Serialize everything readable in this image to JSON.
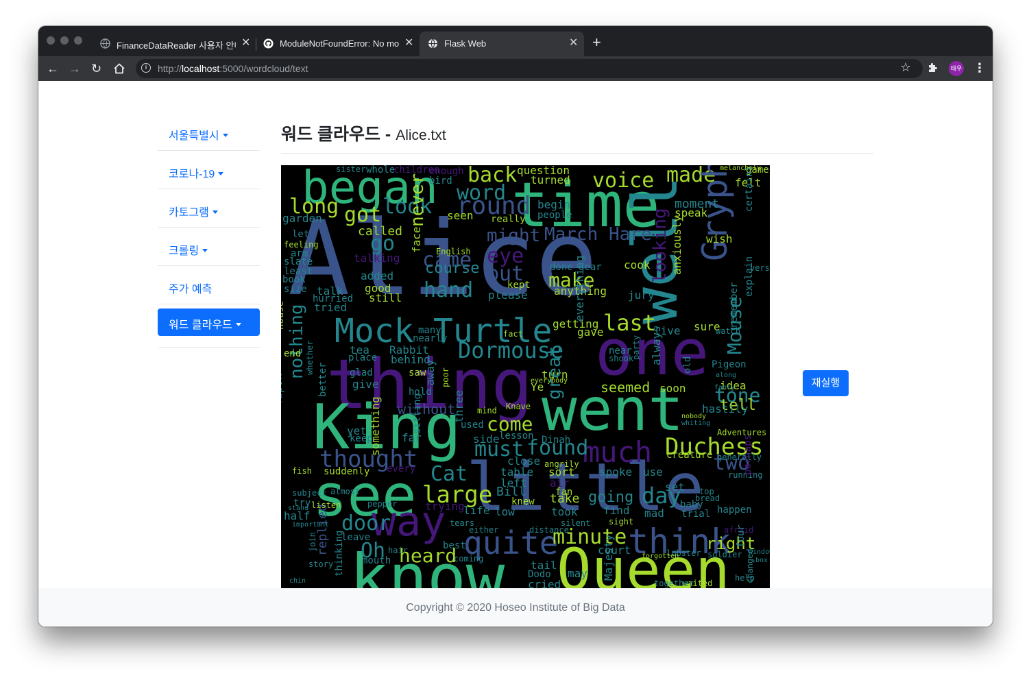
{
  "browser": {
    "tabs": [
      {
        "title": "FinanceDataReader 사용자 안내서",
        "icon": "globe-icon"
      },
      {
        "title": "ModuleNotFoundError: No module",
        "icon": "github-icon"
      },
      {
        "title": "Flask Web",
        "icon": "globe-icon",
        "active": true
      }
    ],
    "url_scheme": "http://",
    "url_host": "localhost",
    "url_rest": ":5000/wordcloud/text",
    "avatar_text": "태우"
  },
  "sidebar": {
    "items": [
      {
        "label": "서울특별시",
        "dropdown": true
      },
      {
        "label": "코로나-19",
        "dropdown": true
      },
      {
        "label": "카토그램",
        "dropdown": true
      },
      {
        "label": "크롤링",
        "dropdown": true
      },
      {
        "label": "주가 예측",
        "dropdown": false
      },
      {
        "label": "워드 클라우드",
        "dropdown": true,
        "active": true
      }
    ]
  },
  "main": {
    "title": "워드 클라우드",
    "separator": "-",
    "filename": "Alice.txt",
    "rerun_label": "재실행"
  },
  "wordcloud": {
    "colors": {
      "green": "#2fb47c",
      "lime": "#a6db2d",
      "teal": "#24868e",
      "blue": "#3a538b",
      "purple": "#46177a",
      "cyan": "#1fa187",
      "yellowgreen": "#7ad151"
    },
    "words": [
      "Alice",
      "time",
      "well",
      "one",
      "thing",
      "King",
      "went",
      "see",
      "little",
      "know",
      "Queen",
      "began",
      "voice",
      "back",
      "word",
      "made",
      "Gryphon",
      "Mock",
      "Turtle",
      "Dormouse",
      "Duchess",
      "much",
      "must",
      "found",
      "thought",
      "large",
      "way",
      "quite",
      "minute",
      "think",
      "heard",
      "door",
      "Oh",
      "right",
      "two",
      "tone",
      "come",
      "Cat",
      "Bill",
      "day",
      "going",
      "take",
      "last",
      "looking",
      "Mouse",
      "first",
      "nothing",
      "long",
      "got",
      "look",
      "round",
      "seen",
      "might",
      "March",
      "Hare",
      "go",
      "came",
      "course",
      "eye",
      "put",
      "make",
      "hand",
      "never",
      "face",
      "garden",
      "called",
      "talking",
      "added",
      "good",
      "still",
      "said",
      "moment",
      "speak",
      "felt",
      "wish",
      "sure",
      "live",
      "tea",
      "Rabbit",
      "behind",
      "saw",
      "hold",
      "give",
      "glad",
      "without",
      "yet",
      "keep",
      "far",
      "side",
      "mind",
      "close",
      "table",
      "sort",
      "spoke",
      "use",
      "left",
      "knew",
      "took",
      "find",
      "mad",
      "happen",
      "sight",
      "court",
      "lobster",
      "soldier",
      "waited",
      "mouth",
      "leave",
      "Dodo",
      "cried",
      "gave",
      "getting",
      "near",
      "shook",
      "seemed",
      "soon",
      "idea",
      "Ye",
      "turn",
      "great",
      "sitting",
      "tell",
      "hastily",
      "creature",
      "Adventures",
      "afraid",
      "help",
      "Majesty",
      "question",
      "turned",
      "people",
      "begin",
      "jury",
      "anything",
      "kept",
      "please",
      "dear",
      "done",
      "cook",
      "replied",
      "suddenly",
      "every",
      "something",
      "three",
      "used",
      "lesson",
      "Dinah",
      "trying",
      "life",
      "low",
      "fish",
      "half",
      "together",
      "whole",
      "children",
      "sister",
      "enough",
      "bird",
      "game",
      "melancholy",
      "really",
      "English",
      "tried",
      "hurried",
      "talk",
      "arm",
      "slate",
      "least",
      "book",
      "size",
      "feeling",
      "let",
      "anxiously",
      "everything",
      "remember",
      "explain",
      "certainly",
      "verse",
      "away",
      "upon",
      "house",
      "end",
      "place",
      "whether",
      "better",
      "appeared",
      "poor",
      "fact",
      "nearly",
      "many",
      "Knave",
      "everybody",
      "angrily",
      "fan",
      "air",
      "baby",
      "trial",
      "running",
      "generally",
      "perhaps",
      "nobody",
      "whiting",
      "Pigeon",
      "party",
      "always",
      "old",
      "watch",
      "fancy",
      "along",
      "set",
      "top",
      "bread",
      "almost",
      "listen",
      "pepper",
      "tears",
      "either",
      "silent",
      "distance",
      "best",
      "hair",
      "join",
      "thinking",
      "story",
      "coming",
      "tail",
      "may",
      "forgotten",
      "window",
      "box",
      "four",
      "changed",
      "subject",
      "important",
      "stand",
      "try",
      "chin"
    ]
  }
}
